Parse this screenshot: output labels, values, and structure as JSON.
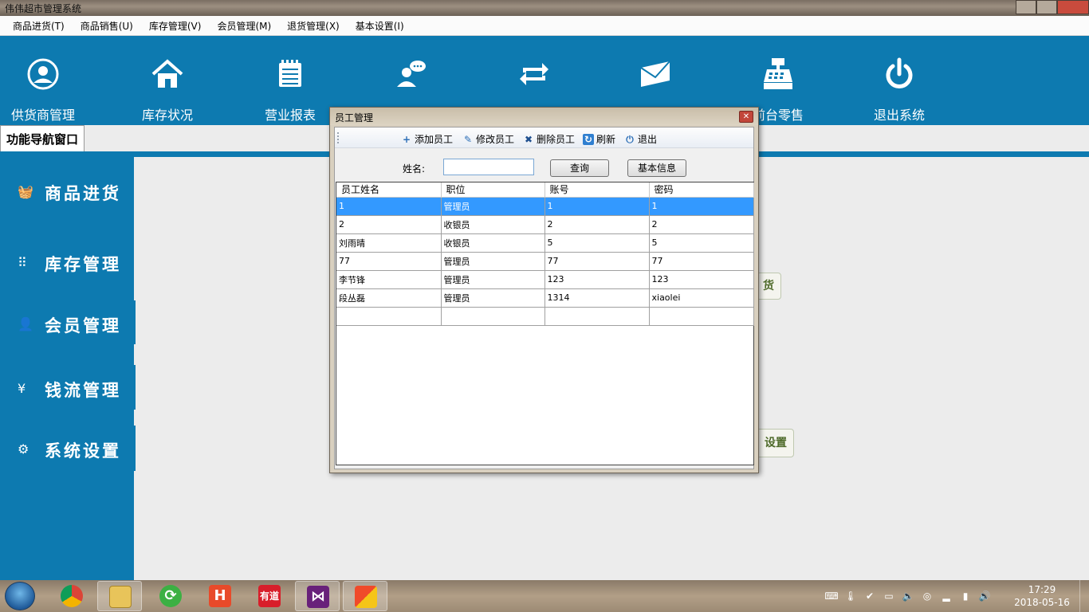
{
  "window": {
    "title": "伟伟超市管理系统"
  },
  "menu": [
    "商品进货(T)",
    "商品销售(U)",
    "库存管理(V)",
    "会员管理(M)",
    "退货管理(X)",
    "基本设置(I)"
  ],
  "toolbar": {
    "items": [
      {
        "label": "供货商管理",
        "icon": "user-circle-icon"
      },
      {
        "label": "库存状况",
        "icon": "home-icon"
      },
      {
        "label": "营业报表",
        "icon": "notepad-icon"
      },
      {
        "label": "",
        "icon": "contact-chat-icon"
      },
      {
        "label": "",
        "icon": "refresh-arrows-icon"
      },
      {
        "label": "",
        "icon": "envelope-icon"
      },
      {
        "label": "前台零售",
        "icon": "cash-register-icon"
      },
      {
        "label": "退出系统",
        "icon": "power-icon"
      }
    ]
  },
  "nav_tab": "功能导航窗口",
  "sidebar": {
    "items": [
      {
        "label": "商品进货",
        "icon": "basket-icon",
        "glyph": "🧺"
      },
      {
        "label": "库存管理",
        "icon": "grid-icon",
        "glyph": "⠿"
      },
      {
        "label": "会员管理",
        "icon": "person-icon",
        "glyph": "👤"
      },
      {
        "label": "钱流管理",
        "icon": "yen-icon",
        "glyph": "¥"
      },
      {
        "label": "系统设置",
        "icon": "gear-icon",
        "glyph": "⚙"
      }
    ]
  },
  "background": {
    "btn1": "货",
    "btn2": "设置"
  },
  "dialog": {
    "title": "员工管理",
    "toolbar": [
      {
        "label": "添加员工",
        "icon": "plus-icon",
        "glyph": "+"
      },
      {
        "label": "修改员工",
        "icon": "pencil-icon",
        "glyph": "✎"
      },
      {
        "label": "删除员工",
        "icon": "x-icon",
        "glyph": "✖"
      },
      {
        "label": "刷新",
        "icon": "refresh-icon",
        "glyph": "↻"
      },
      {
        "label": "退出",
        "icon": "power-small-icon",
        "glyph": "⏻"
      }
    ],
    "search_label": "姓名:",
    "search_value": "",
    "query_button": "查询",
    "info_button": "基本信息",
    "columns": [
      "员工姓名",
      "职位",
      "账号",
      "密码"
    ],
    "rows": [
      [
        "1",
        "管理员",
        "1",
        "1"
      ],
      [
        "2",
        "收银员",
        "2",
        "2"
      ],
      [
        "刘雨晴",
        "收银员",
        "5",
        "5"
      ],
      [
        "77",
        "管理员",
        "77",
        "77"
      ],
      [
        "李节锋",
        "管理员",
        "123",
        "123"
      ],
      [
        "段丛磊",
        "管理员",
        "1314",
        "xiaolei"
      ],
      [
        "",
        "",
        "",
        ""
      ]
    ]
  },
  "taskbar": {
    "apps": [
      "start-icon",
      "chrome-icon",
      "explorer-icon",
      "green-refresh-icon",
      "hbuilder-icon",
      "youdao-icon",
      "visual-studio-icon",
      "winform-app-icon"
    ],
    "time": "17:29",
    "date": "2018-05-16"
  },
  "colors": {
    "primary": "#0d7ab0",
    "selection": "#3399ff"
  }
}
